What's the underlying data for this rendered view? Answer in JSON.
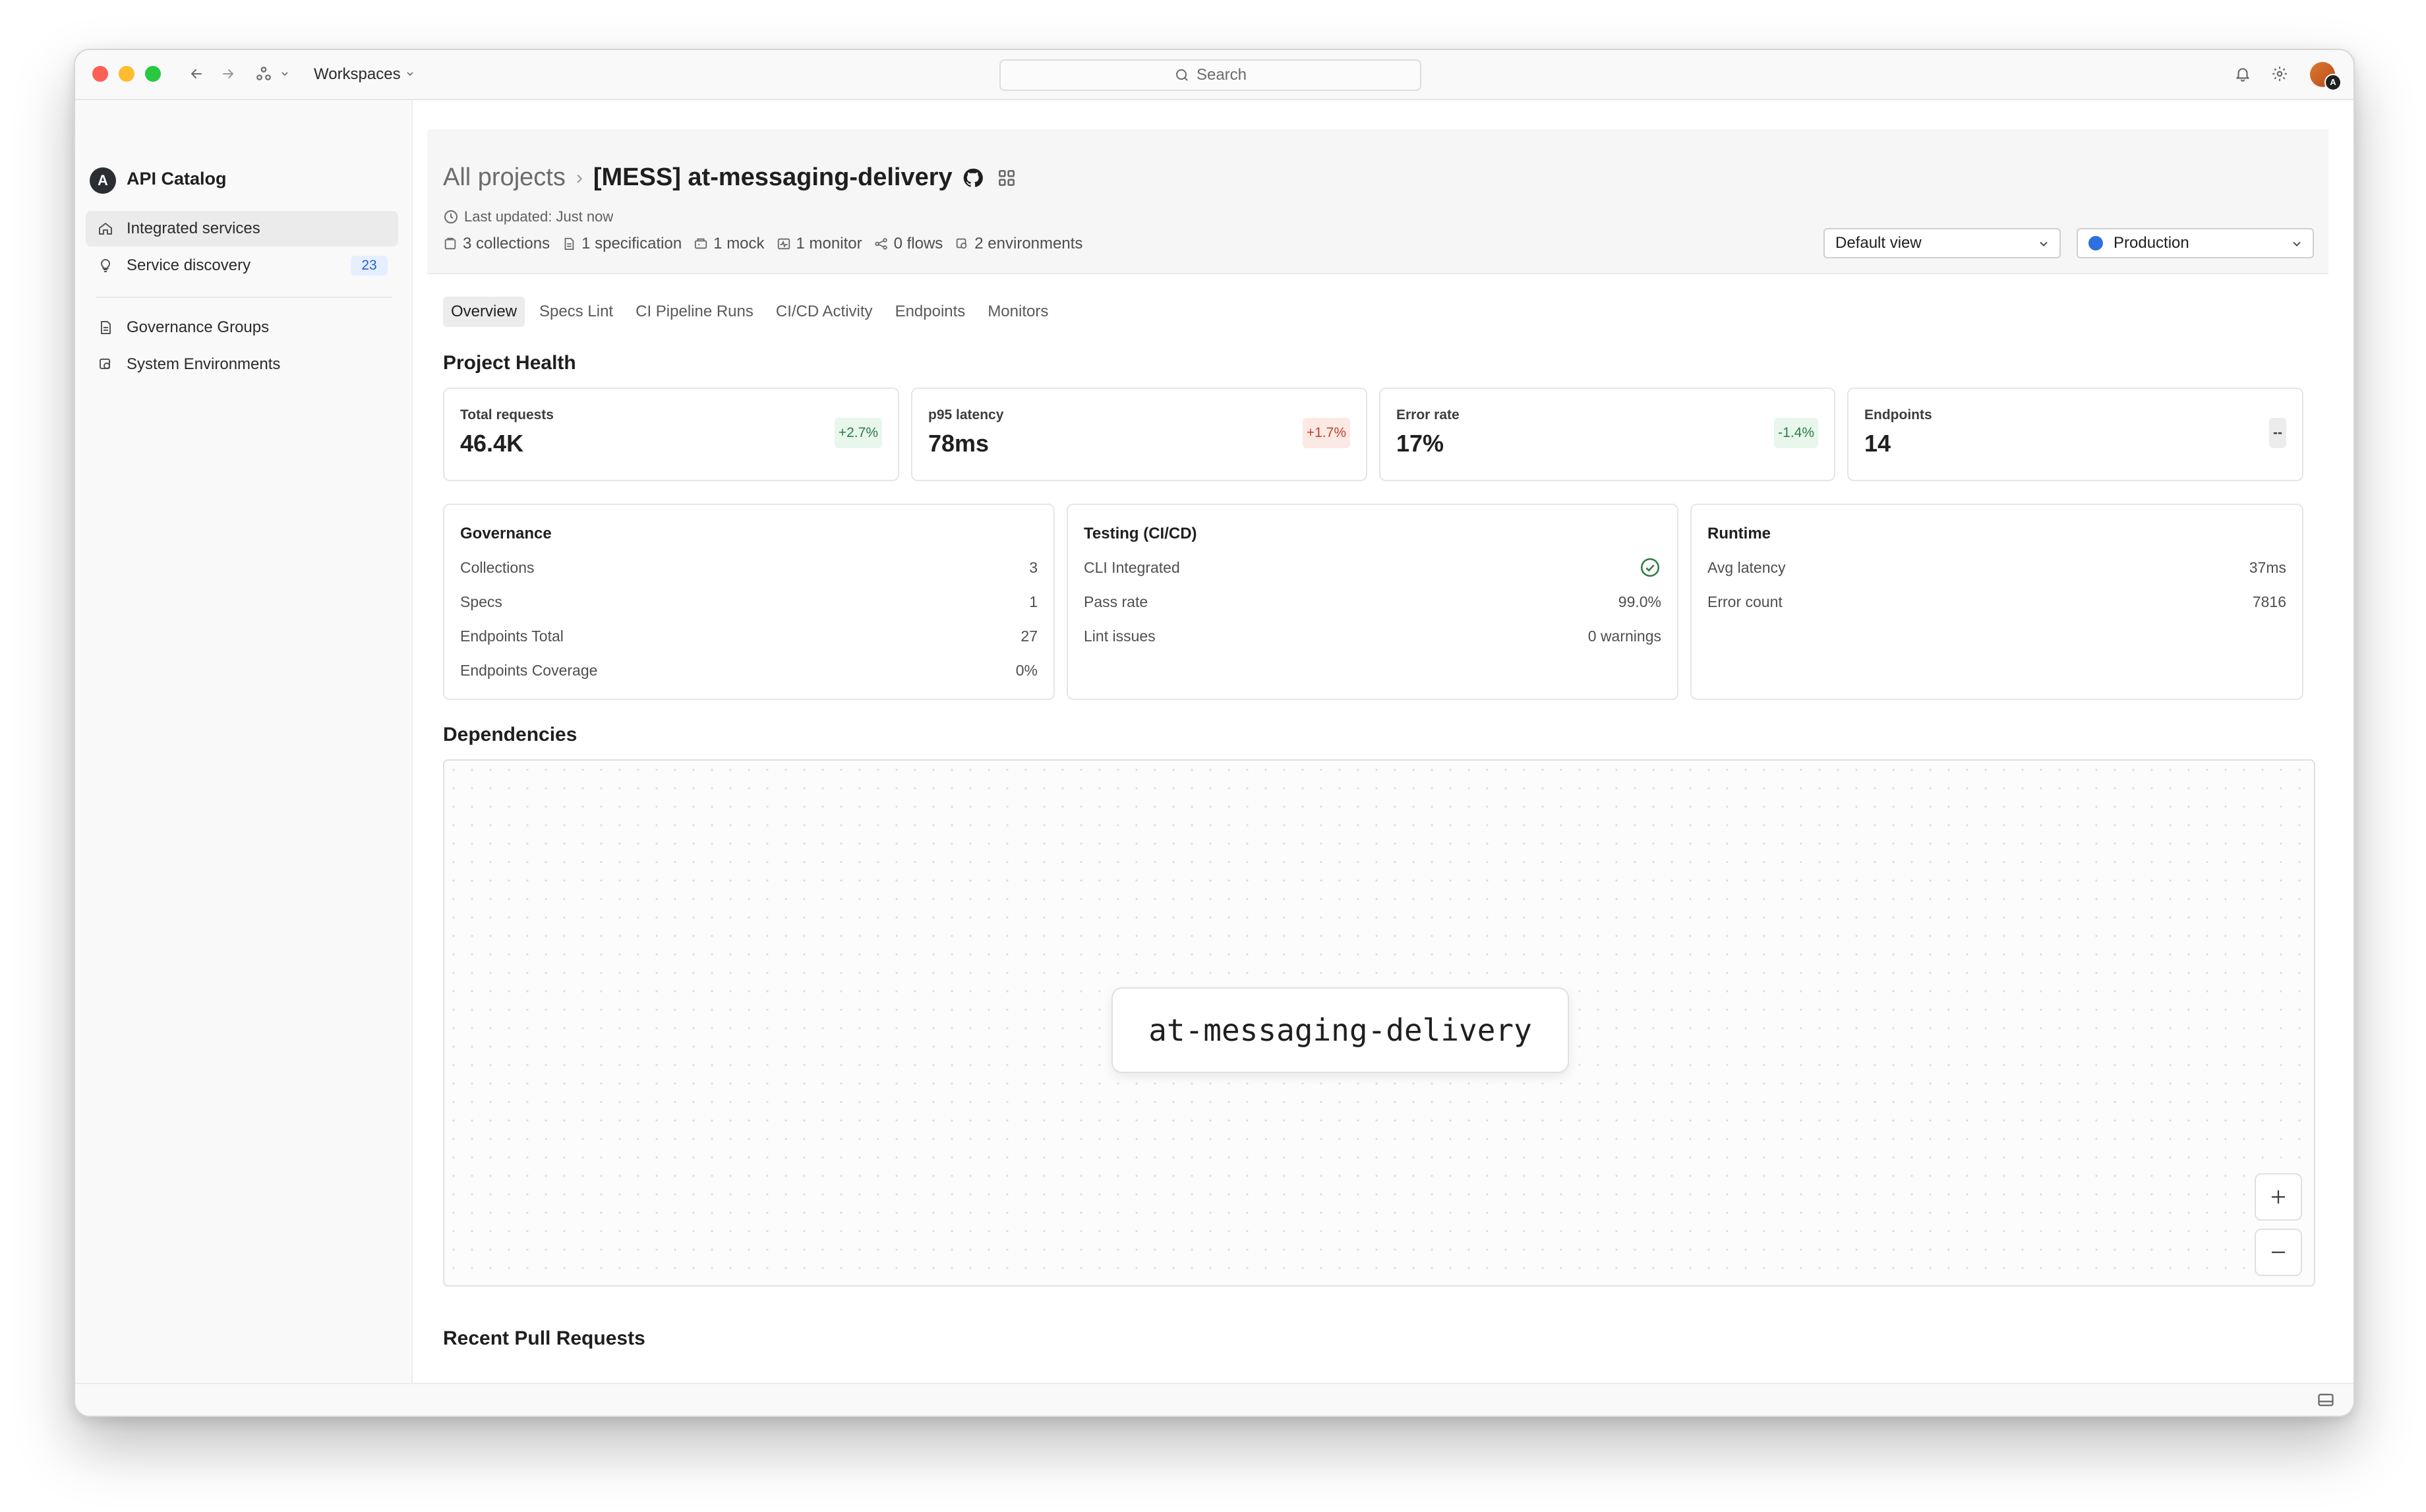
{
  "titlebar": {
    "workspace_label": "Workspaces",
    "search_placeholder": "Search",
    "icons": [
      "back-arrow-icon",
      "forward-arrow-icon",
      "workspace-switch-icon",
      "chevron-down-icon",
      "search-icon",
      "bell-icon",
      "gear-icon"
    ],
    "avatar_badge": "A"
  },
  "sidebar": {
    "logo_letter": "A",
    "app_name": "API Catalog",
    "items": [
      {
        "label": "Integrated services",
        "icon": "home-icon",
        "active": true
      },
      {
        "label": "Service discovery",
        "icon": "lightbulb-icon",
        "badge": "23"
      },
      {
        "label": "Governance Groups",
        "icon": "document-icon"
      },
      {
        "label": "System Environments",
        "icon": "environment-icon"
      }
    ]
  },
  "header": {
    "breadcrumb_root": "All projects",
    "breadcrumb_separator": "›",
    "project_name": "[MESS] at-messaging-delivery",
    "last_updated": "Last updated: Just now",
    "meta": [
      {
        "text": "3 collections",
        "icon": "collection-icon"
      },
      {
        "text": "1 specification",
        "icon": "file-icon"
      },
      {
        "text": "1 mock",
        "icon": "mock-server-icon"
      },
      {
        "text": "1 monitor",
        "icon": "monitor-icon"
      },
      {
        "text": "0 flows",
        "icon": "flow-icon"
      },
      {
        "text": "2 environments",
        "icon": "environment-icon"
      }
    ],
    "view_select": "Default view",
    "env_select": "Production",
    "env_color": "#2f6fe0"
  },
  "tabs": [
    "Overview",
    "Specs Lint",
    "CI Pipeline Runs",
    "CI/CD Activity",
    "Endpoints",
    "Monitors"
  ],
  "active_tab": "Overview",
  "project_health": {
    "title": "Project Health",
    "stats": [
      {
        "label": "Total requests",
        "value": "46.4K",
        "delta": "+2.7%",
        "trend": "good"
      },
      {
        "label": "p95 latency",
        "value": "78ms",
        "delta": "+1.7%",
        "trend": "bad"
      },
      {
        "label": "Error rate",
        "value": "17%",
        "delta": "-1.4%",
        "trend": "good"
      },
      {
        "label": "Endpoints",
        "value": "14",
        "delta": "--",
        "trend": "neutral"
      }
    ]
  },
  "governance": {
    "title": "Governance",
    "rows": [
      {
        "label": "Collections",
        "value": "3"
      },
      {
        "label": "Specs",
        "value": "1"
      },
      {
        "label": "Endpoints Total",
        "value": "27"
      },
      {
        "label": "Endpoints Coverage",
        "value": "0%"
      }
    ]
  },
  "testing": {
    "title": "Testing (CI/CD)",
    "rows": [
      {
        "label": "CLI Integrated",
        "value": "",
        "icon": "check-circle-icon"
      },
      {
        "label": "Pass rate",
        "value": "99.0%"
      },
      {
        "label": "Lint issues",
        "value": "0 warnings"
      }
    ]
  },
  "runtime": {
    "title": "Runtime",
    "rows": [
      {
        "label": "Avg latency",
        "value": "37ms"
      },
      {
        "label": "Error count",
        "value": "7816"
      }
    ]
  },
  "dependencies": {
    "title": "Dependencies",
    "node": "at-messaging-delivery",
    "zoom_in": "+",
    "zoom_out": "−"
  },
  "recent_pr": {
    "title": "Recent Pull Requests"
  },
  "colors": {
    "accent": "#2f6fe0",
    "delta_good": "#2e7d43",
    "delta_bad": "#c0442a"
  }
}
